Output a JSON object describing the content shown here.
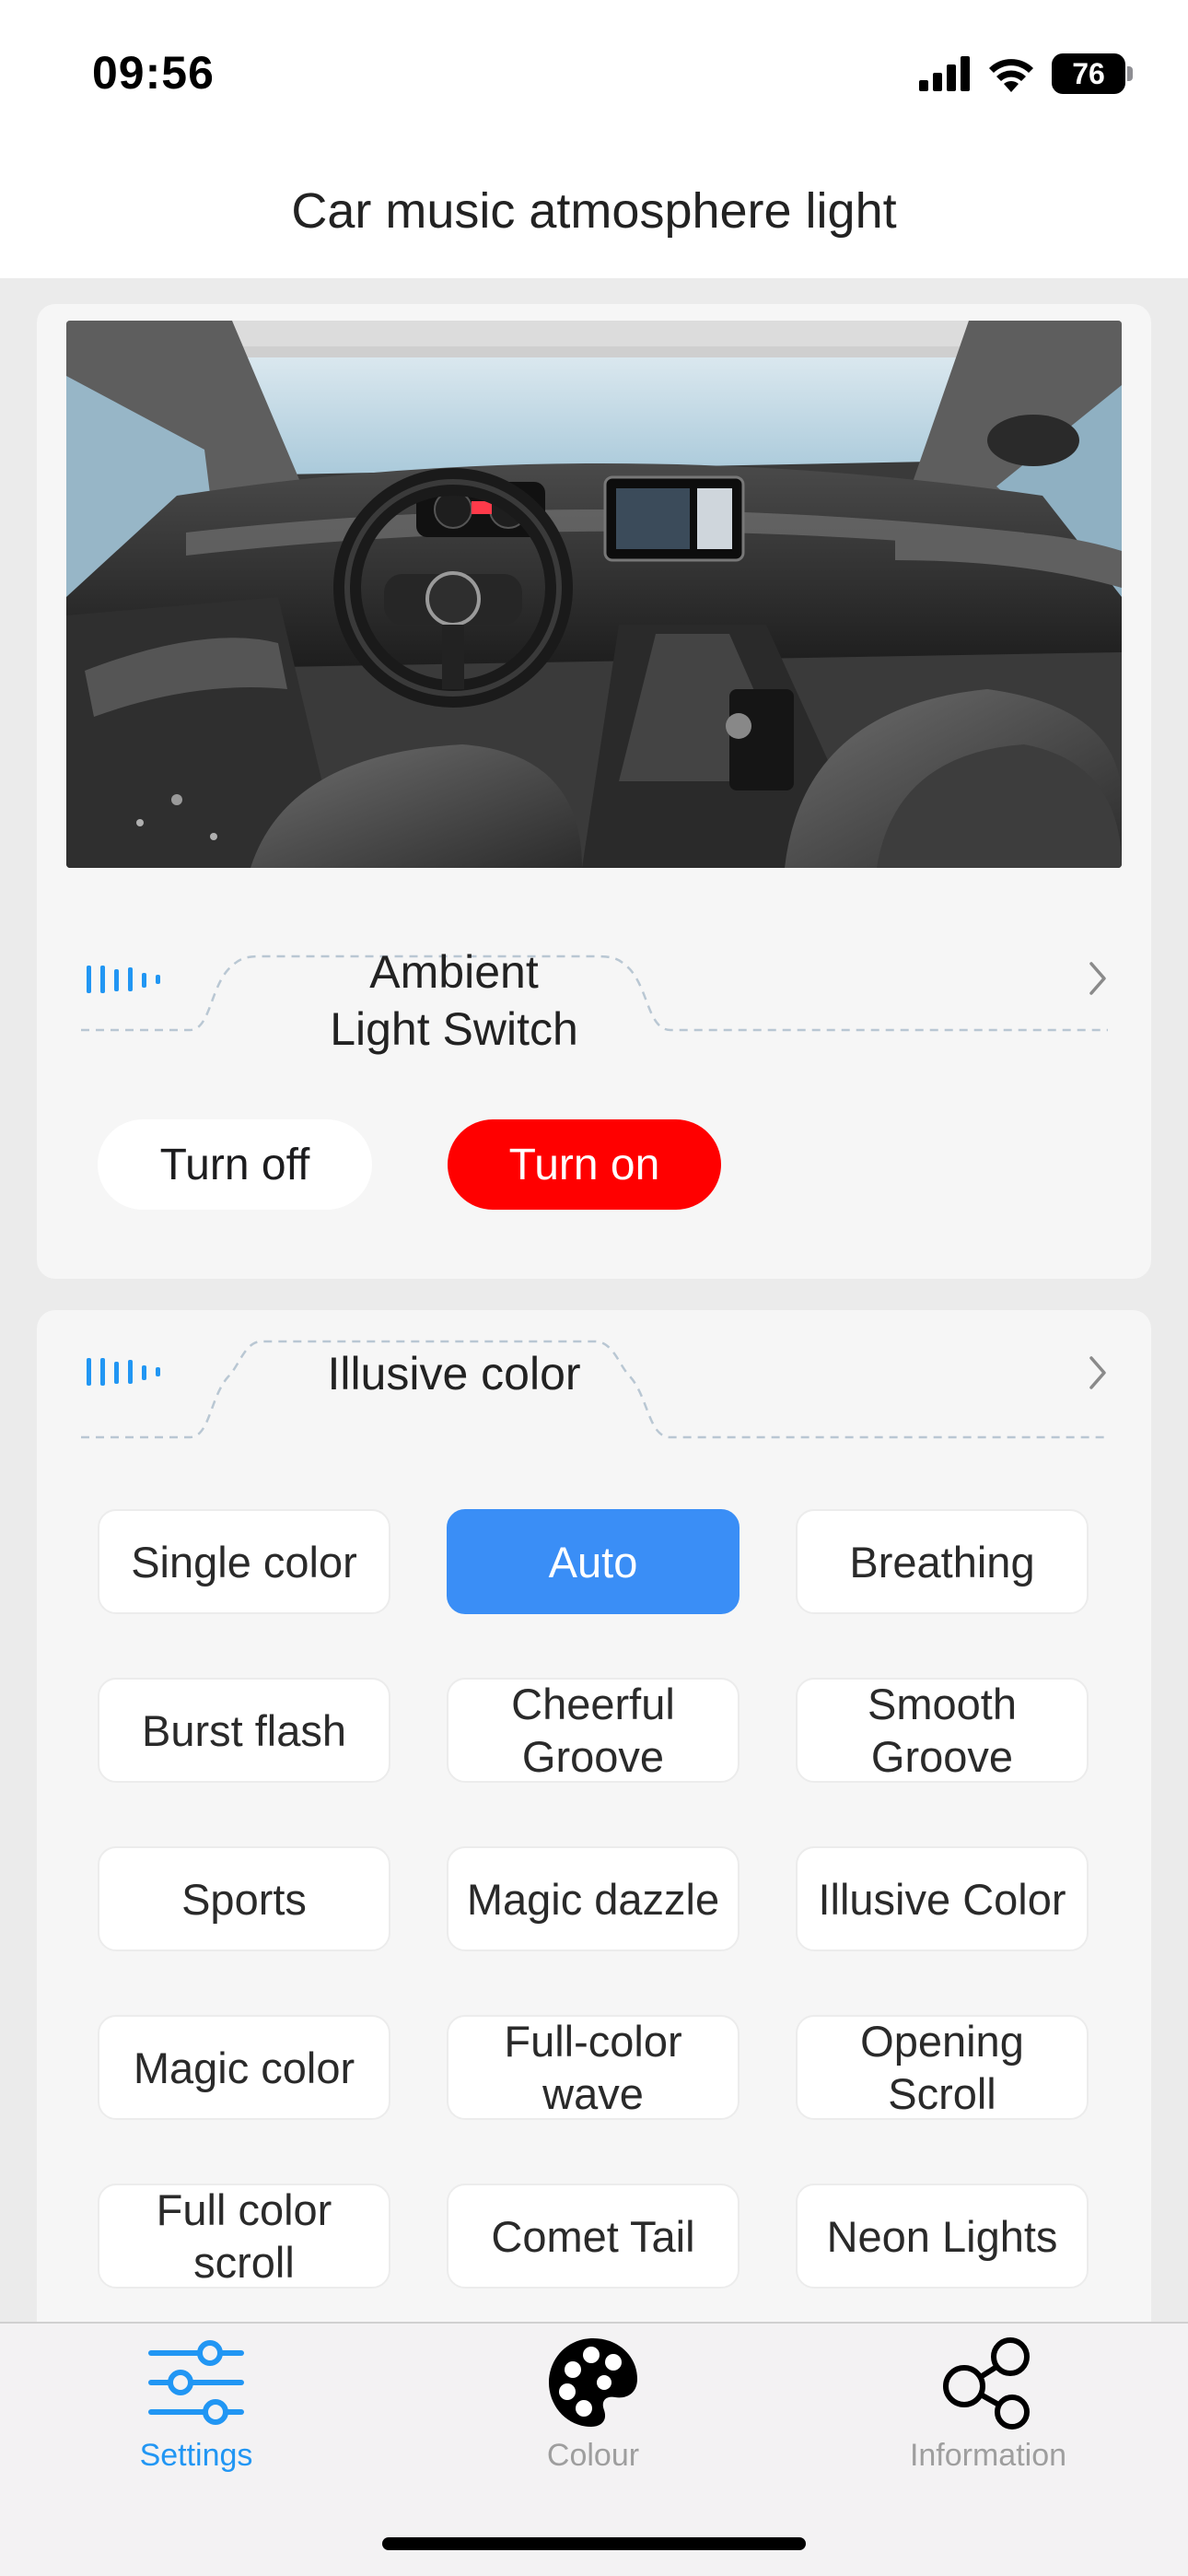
{
  "status_bar": {
    "time": "09:56",
    "battery": "76",
    "icons": [
      "cellular-signal-icon",
      "wifi-icon",
      "battery-icon"
    ]
  },
  "header": {
    "title": "Car music atmosphere light"
  },
  "ambient": {
    "image": "car-interior-photo",
    "title_line1": "Ambient",
    "title_line2": "Light Switch",
    "turn_off_label": "Turn off",
    "turn_on_label": "Turn on",
    "selected": "Turn on"
  },
  "modes": {
    "title": "Illusive color",
    "selected": "Auto",
    "items": [
      [
        "Single color"
      ],
      [
        "Auto"
      ],
      [
        "Breathing"
      ],
      [
        "Burst flash"
      ],
      [
        "Cheerful",
        "Groove"
      ],
      [
        "Smooth",
        "Groove"
      ],
      [
        "Sports"
      ],
      [
        "Magic dazzle"
      ],
      [
        "Illusive Color"
      ],
      [
        "Magic color"
      ],
      [
        "Full-color",
        "wave"
      ],
      [
        "Opening",
        "Scroll"
      ],
      [
        "Full color",
        "scroll"
      ],
      [
        "Comet Tail"
      ],
      [
        "Neon Lights"
      ]
    ]
  },
  "tabbar": {
    "active": "Settings",
    "tabs": [
      {
        "label": "Settings",
        "icon": "sliders-icon"
      },
      {
        "label": "Colour",
        "icon": "palette-icon"
      },
      {
        "label": "Information",
        "icon": "share-nodes-icon"
      }
    ]
  },
  "colors": {
    "accent_blue": "#3a8ef6",
    "tab_active": "#2196f3",
    "tab_inactive": "#9e9e9e",
    "turn_on_red": "#ff0000",
    "section_icon": "#2196f3"
  }
}
